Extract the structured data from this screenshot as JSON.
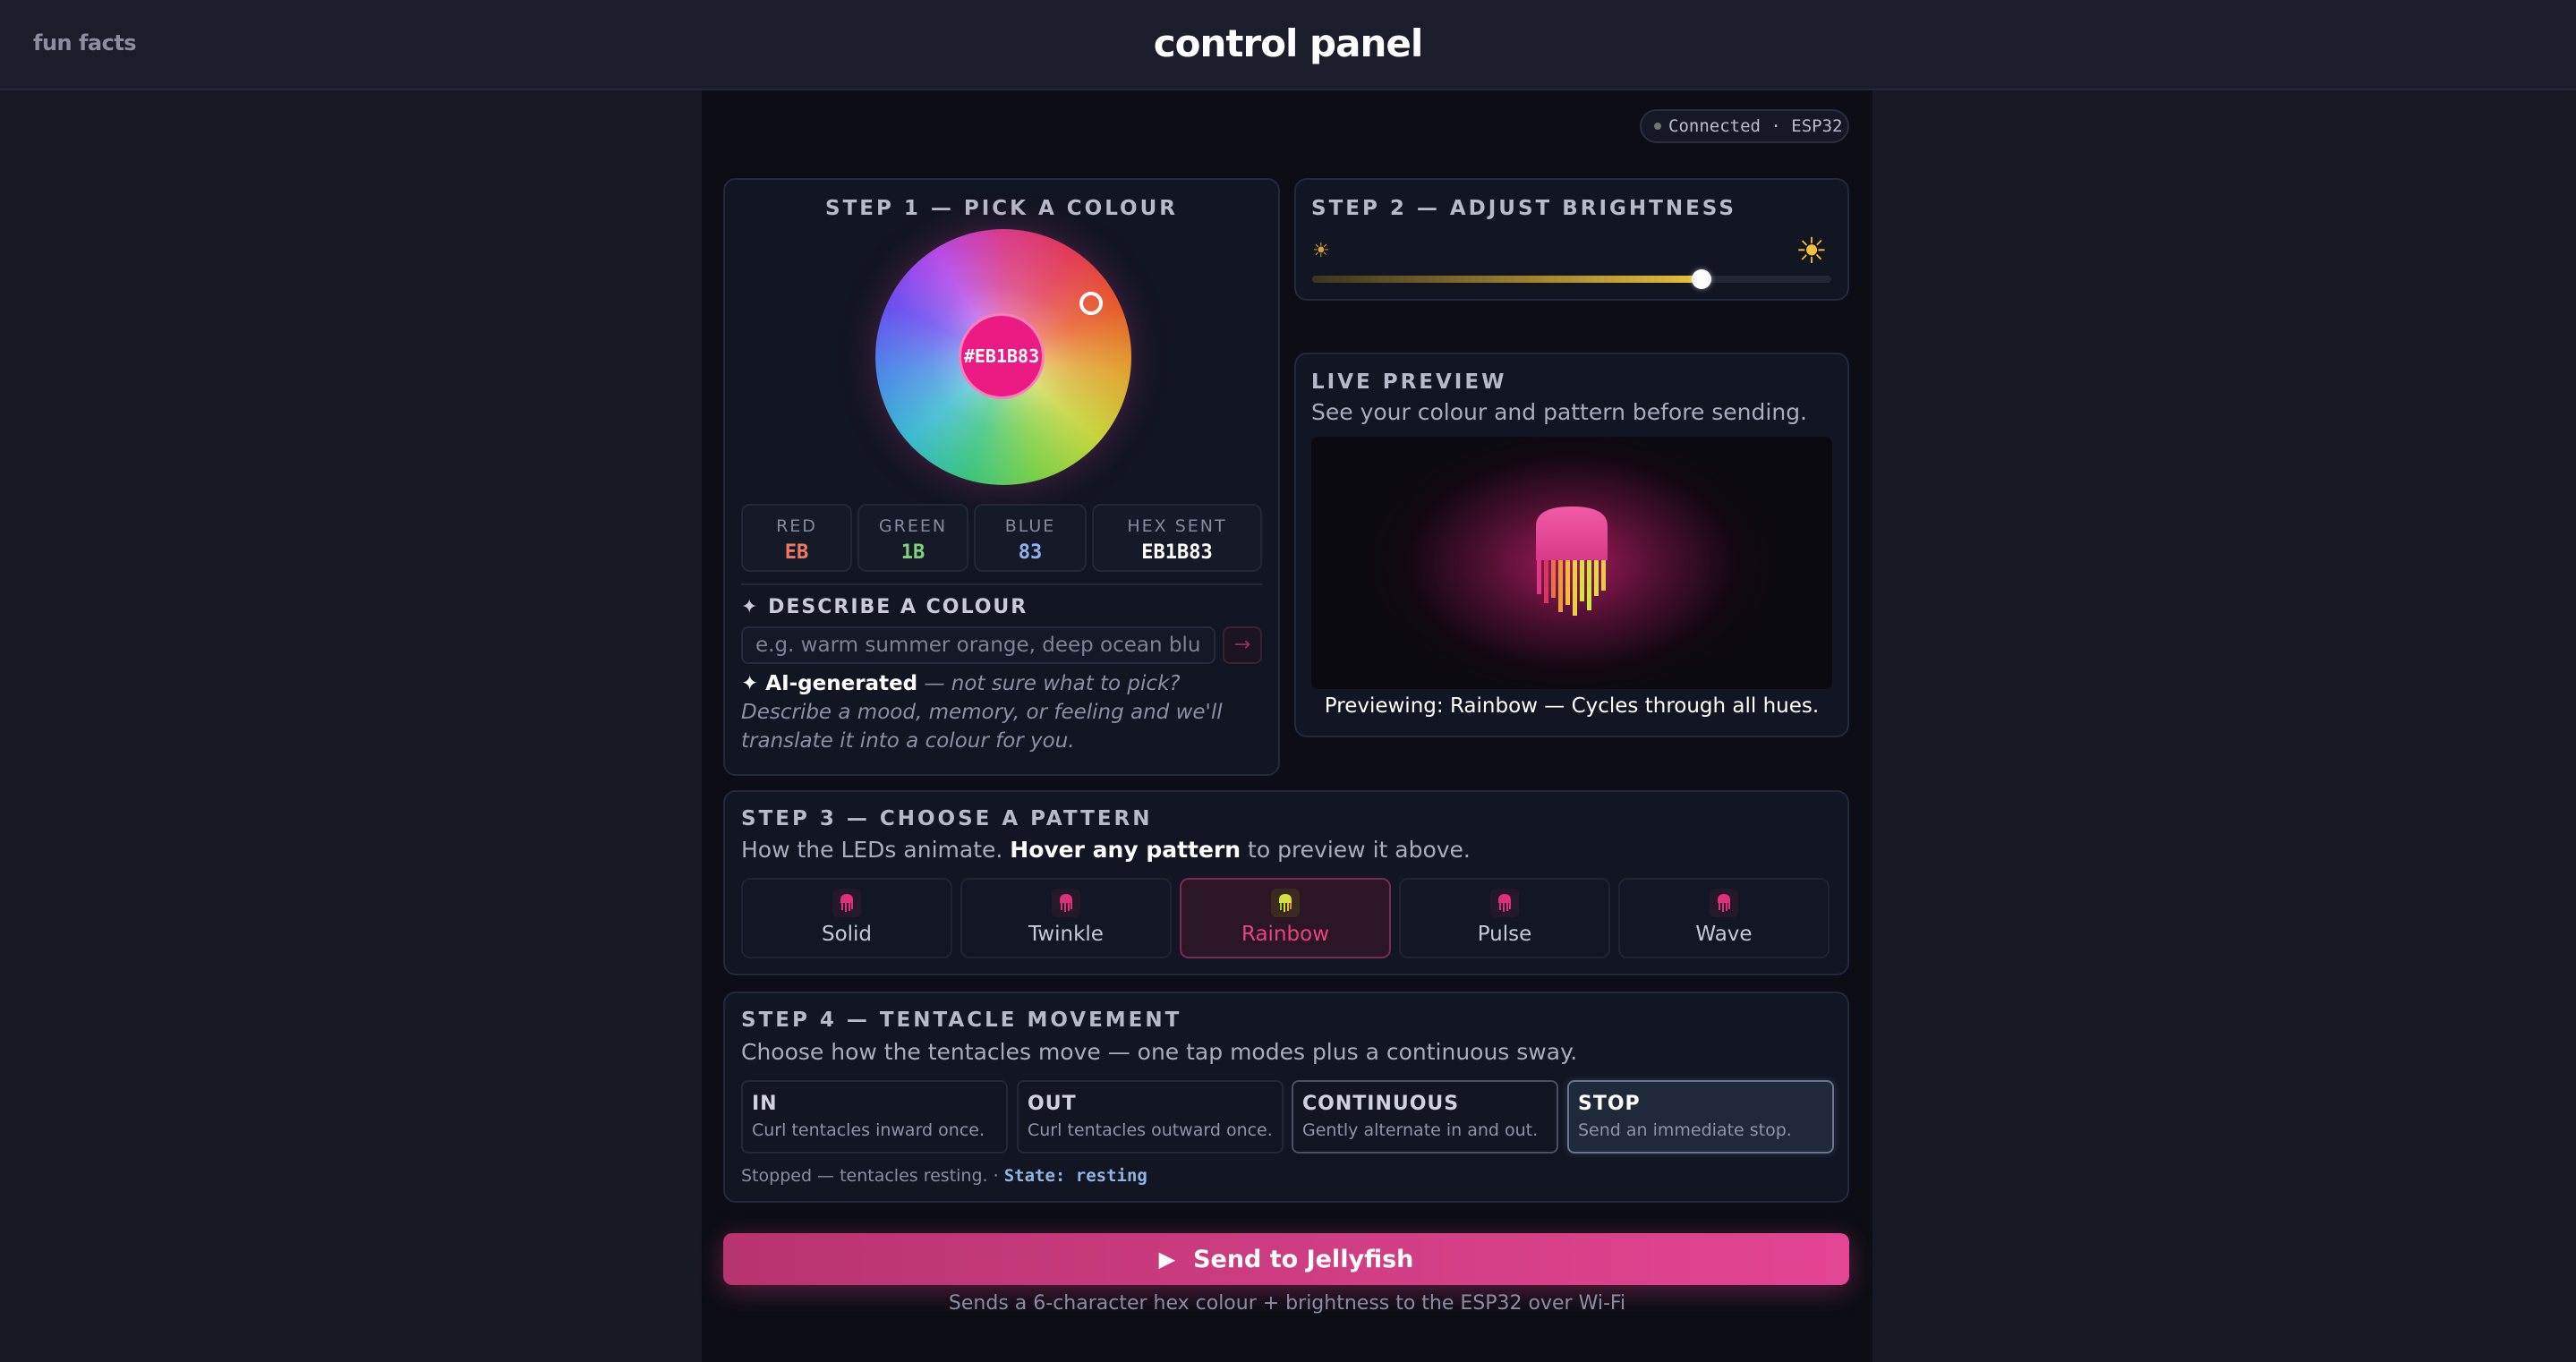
{
  "header": {
    "fun_facts": "fun facts",
    "title": "control panel"
  },
  "connection": {
    "status": "Connected · ESP32"
  },
  "step1": {
    "title": "STEP 1 — PICK A COLOUR",
    "hex_display": "#EB1B83",
    "selected_color": "#EB1B83",
    "red": {
      "label": "RED",
      "value": "EB",
      "color": "#f07a63"
    },
    "green": {
      "label": "GREEN",
      "value": "1B",
      "color": "#7fd27a"
    },
    "blue": {
      "label": "BLUE",
      "value": "83",
      "color": "#8fb3f0"
    },
    "hex_sent": {
      "label": "HEX SENT",
      "value": "EB1B83"
    },
    "describe_title": "✦ DESCRIBE A COLOUR",
    "describe_placeholder": "e.g. warm summer orange, deep ocean blue…",
    "go_icon": "→",
    "ai_label": "✦ AI-generated",
    "ai_text": " — not sure what to pick? Describe a mood, memory, or feeling and we'll translate it into a colour for you."
  },
  "step2": {
    "title": "STEP 2 — ADJUST BRIGHTNESS",
    "brightness_fraction": 0.75,
    "sun_small_icon": "☀",
    "sun_big_icon": "☀"
  },
  "preview": {
    "title": "LIVE PREVIEW",
    "subtitle": "See your colour and pattern before sending.",
    "caption": "Previewing: Rainbow — Cycles through all hues."
  },
  "step3": {
    "title": "STEP 3 — CHOOSE A PATTERN",
    "subtitle_a": "How the LEDs animate. ",
    "subtitle_b": "Hover any pattern",
    "subtitle_c": " to preview it above.",
    "patterns": [
      {
        "label": "Solid",
        "active": false
      },
      {
        "label": "Twinkle",
        "active": false
      },
      {
        "label": "Rainbow",
        "active": true
      },
      {
        "label": "Pulse",
        "active": false
      },
      {
        "label": "Wave",
        "active": false
      }
    ]
  },
  "step4": {
    "title": "STEP 4 — TENTACLE MOVEMENT",
    "subtitle": "Choose how the tentacles move — one tap modes plus a continuous sway.",
    "modes": [
      {
        "label": "IN",
        "desc": "Curl tentacles inward once."
      },
      {
        "label": "OUT",
        "desc": "Curl tentacles outward once."
      },
      {
        "label": "CONTINUOUS",
        "desc": "Gently alternate in and out."
      },
      {
        "label": "STOP",
        "desc": "Send an immediate stop."
      }
    ],
    "status_text": "Stopped — tentacles resting.",
    "separator": " · ",
    "state": "State: resting"
  },
  "send": {
    "label": "Send to Jellyfish",
    "note": "Sends a 6-character hex colour + brightness to the ESP32 over Wi-Fi"
  }
}
